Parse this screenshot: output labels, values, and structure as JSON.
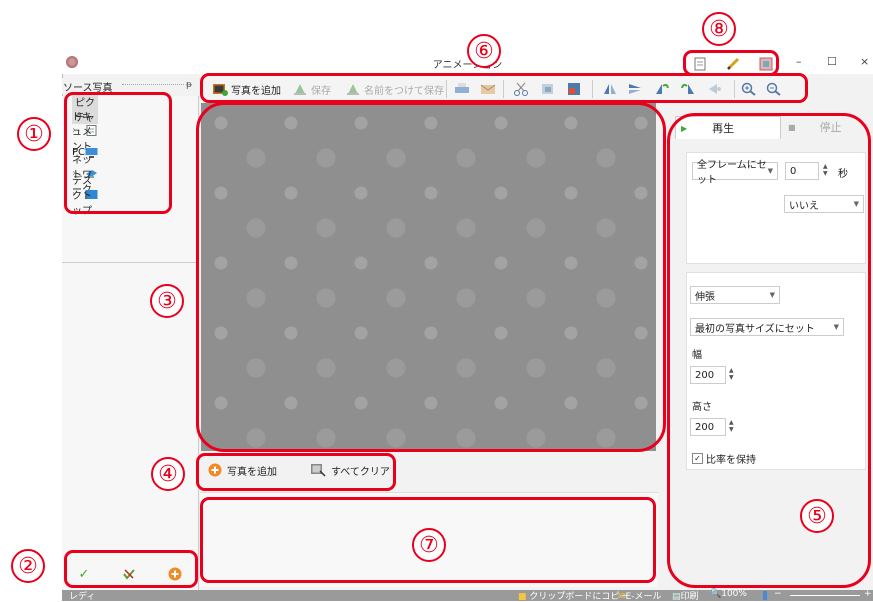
{
  "window": {
    "title": "アニメーション",
    "minimize": "–",
    "maximize": "☐",
    "close": "×"
  },
  "source_panel": {
    "header": "ソース写真",
    "pin": "ᵽ",
    "items": [
      {
        "label": "ピクチャ",
        "icon": "pictures-icon"
      },
      {
        "label": "ドキュメント",
        "icon": "documents-icon"
      },
      {
        "label": "PC",
        "icon": "pc-icon"
      },
      {
        "label": "ネットワーク",
        "icon": "network-icon"
      },
      {
        "label": "デスクトップ",
        "icon": "desktop-icon"
      }
    ]
  },
  "toolbar": {
    "add_photo": "写真を追加",
    "save": "保存",
    "save_as": "名前をつけて保存"
  },
  "bottom_buttons": {
    "add_photo": "写真を追加",
    "clear_all": "すべてクリア"
  },
  "right_panel": {
    "tab_play": "再生",
    "tab_stop": "停止",
    "frame_select": "全フレームにセット",
    "frame_value": "0",
    "seconds_label": "秒",
    "loop_select": "いいえ",
    "stretch_select": "伸張",
    "size_select": "最初の写真サイズにセット",
    "width_label": "幅",
    "width_value": "200",
    "height_label": "高さ",
    "height_value": "200",
    "keep_ratio": "比率を保持",
    "keep_ratio_checked": true
  },
  "status_bar": {
    "ready": "レディ",
    "copy_clipboard": "クリップボードにコピー",
    "email": "E-メール",
    "print": "印刷",
    "zoom": "100%",
    "zoom_minus": "−",
    "zoom_plus": "+",
    "zoom_level": 0.5
  },
  "callouts": [
    "①",
    "②",
    "③",
    "④",
    "⑤",
    "⑥",
    "⑦",
    "⑧"
  ],
  "colors": {
    "callout_red": "#e8001c",
    "canvas_gray": "#8f8f8f",
    "add_orange": "#f08a24",
    "check_green": "#3aa83a"
  }
}
